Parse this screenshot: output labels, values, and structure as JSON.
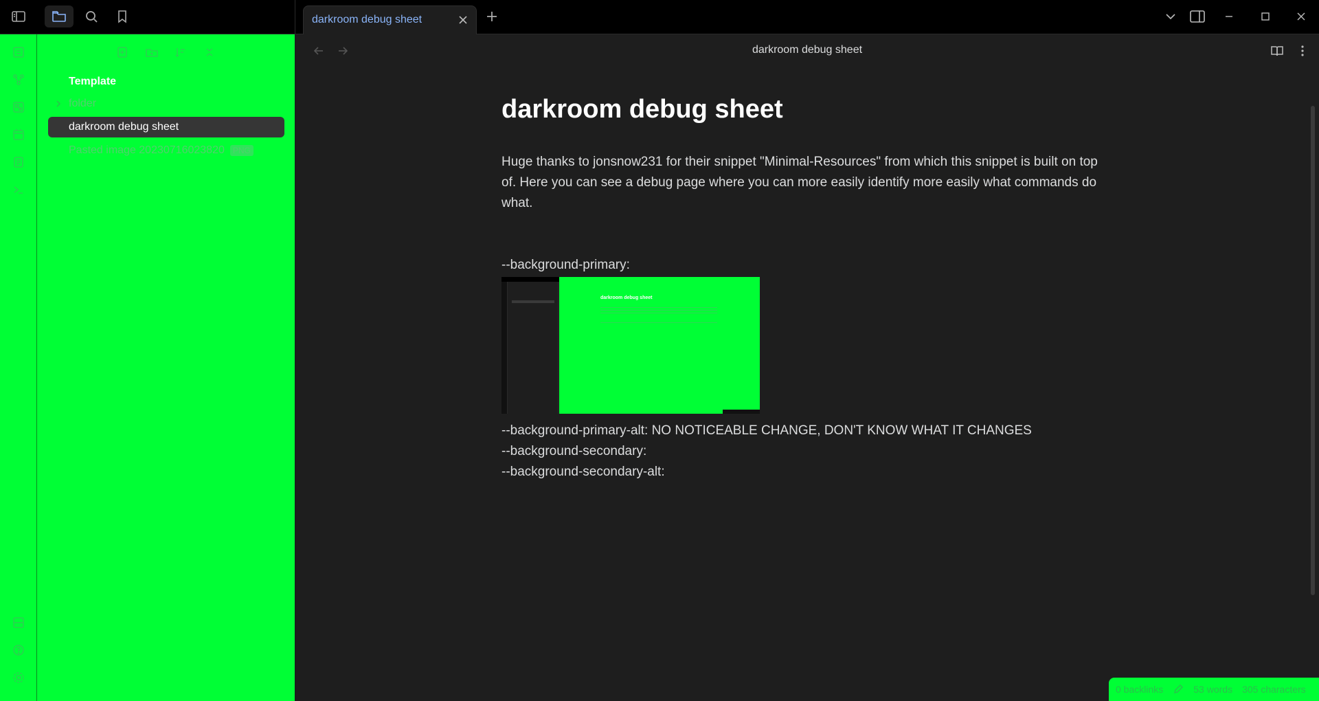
{
  "app": {
    "tab": {
      "title": "darkroom debug sheet"
    }
  },
  "sidebar": {
    "vault_name": "Template",
    "items": [
      {
        "type": "folder",
        "label": "folder"
      },
      {
        "type": "file",
        "label": "darkroom debug sheet",
        "active": true
      },
      {
        "type": "file",
        "label": "Pasted image 20230716023820",
        "ext": "PNG"
      }
    ]
  },
  "view": {
    "header_title": "darkroom debug sheet"
  },
  "document": {
    "title": "darkroom debug sheet",
    "intro": "Huge thanks to jonsnow231 for their snippet \"Minimal-Resources\" from which this snippet is built on top of. Here you can see a debug page where you can more easily identify more easily what commands do what.",
    "lines": [
      "--background-primary:",
      "--background-primary-alt: NO NOTICEABLE CHANGE, DON'T KNOW WHAT IT CHANGES",
      "--background-secondary:",
      "--background-secondary-alt:"
    ],
    "embed": {
      "title": "darkroom debug sheet",
      "vault": "Template",
      "file": "darkroom debug sheet"
    }
  },
  "status": {
    "backlinks": "0 backlinks",
    "words": "53 words",
    "chars": "305 characters"
  },
  "colors": {
    "accent_green": "#00ff35",
    "background": "#1e1e1e",
    "tab_text": "#8ab4f8"
  }
}
